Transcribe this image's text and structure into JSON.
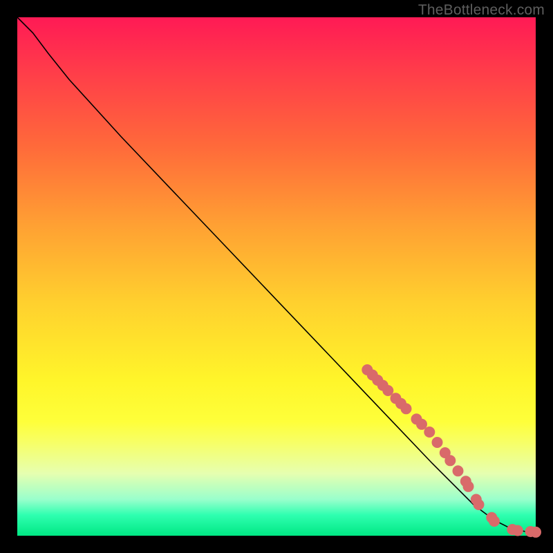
{
  "watermark": "TheBottleneck.com",
  "colors": {
    "dot": "#d96a6a",
    "curve": "#000000",
    "frame": "#000000"
  },
  "chart_data": {
    "type": "line",
    "title": "",
    "xlabel": "",
    "ylabel": "",
    "xlim": [
      0,
      100
    ],
    "ylim": [
      0,
      100
    ],
    "series": [
      {
        "name": "curve",
        "x": [
          0,
          3,
          6,
          10,
          20,
          30,
          40,
          50,
          60,
          70,
          80,
          88,
          92,
          95,
          98,
          100
        ],
        "y": [
          100,
          97,
          93,
          88,
          77,
          66.5,
          56,
          45.5,
          35,
          24.5,
          14,
          6,
          3,
          1.5,
          0.8,
          0.7
        ]
      }
    ],
    "points": [
      {
        "x": 67.5,
        "y": 32.0
      },
      {
        "x": 68.5,
        "y": 31.0
      },
      {
        "x": 69.5,
        "y": 30.0
      },
      {
        "x": 70.5,
        "y": 29.0
      },
      {
        "x": 71.5,
        "y": 28.0
      },
      {
        "x": 73.0,
        "y": 26.5
      },
      {
        "x": 74.0,
        "y": 25.5
      },
      {
        "x": 75.0,
        "y": 24.5
      },
      {
        "x": 77.0,
        "y": 22.5
      },
      {
        "x": 78.0,
        "y": 21.5
      },
      {
        "x": 79.5,
        "y": 20.0
      },
      {
        "x": 81.0,
        "y": 18.0
      },
      {
        "x": 82.5,
        "y": 16.0
      },
      {
        "x": 83.5,
        "y": 14.5
      },
      {
        "x": 85.0,
        "y": 12.5
      },
      {
        "x": 86.5,
        "y": 10.5
      },
      {
        "x": 87.0,
        "y": 9.5
      },
      {
        "x": 88.5,
        "y": 7.0
      },
      {
        "x": 89.0,
        "y": 6.0
      },
      {
        "x": 91.5,
        "y": 3.5
      },
      {
        "x": 92.0,
        "y": 2.8
      },
      {
        "x": 95.5,
        "y": 1.2
      },
      {
        "x": 96.5,
        "y": 1.0
      },
      {
        "x": 99.0,
        "y": 0.8
      },
      {
        "x": 100.0,
        "y": 0.7
      }
    ]
  }
}
